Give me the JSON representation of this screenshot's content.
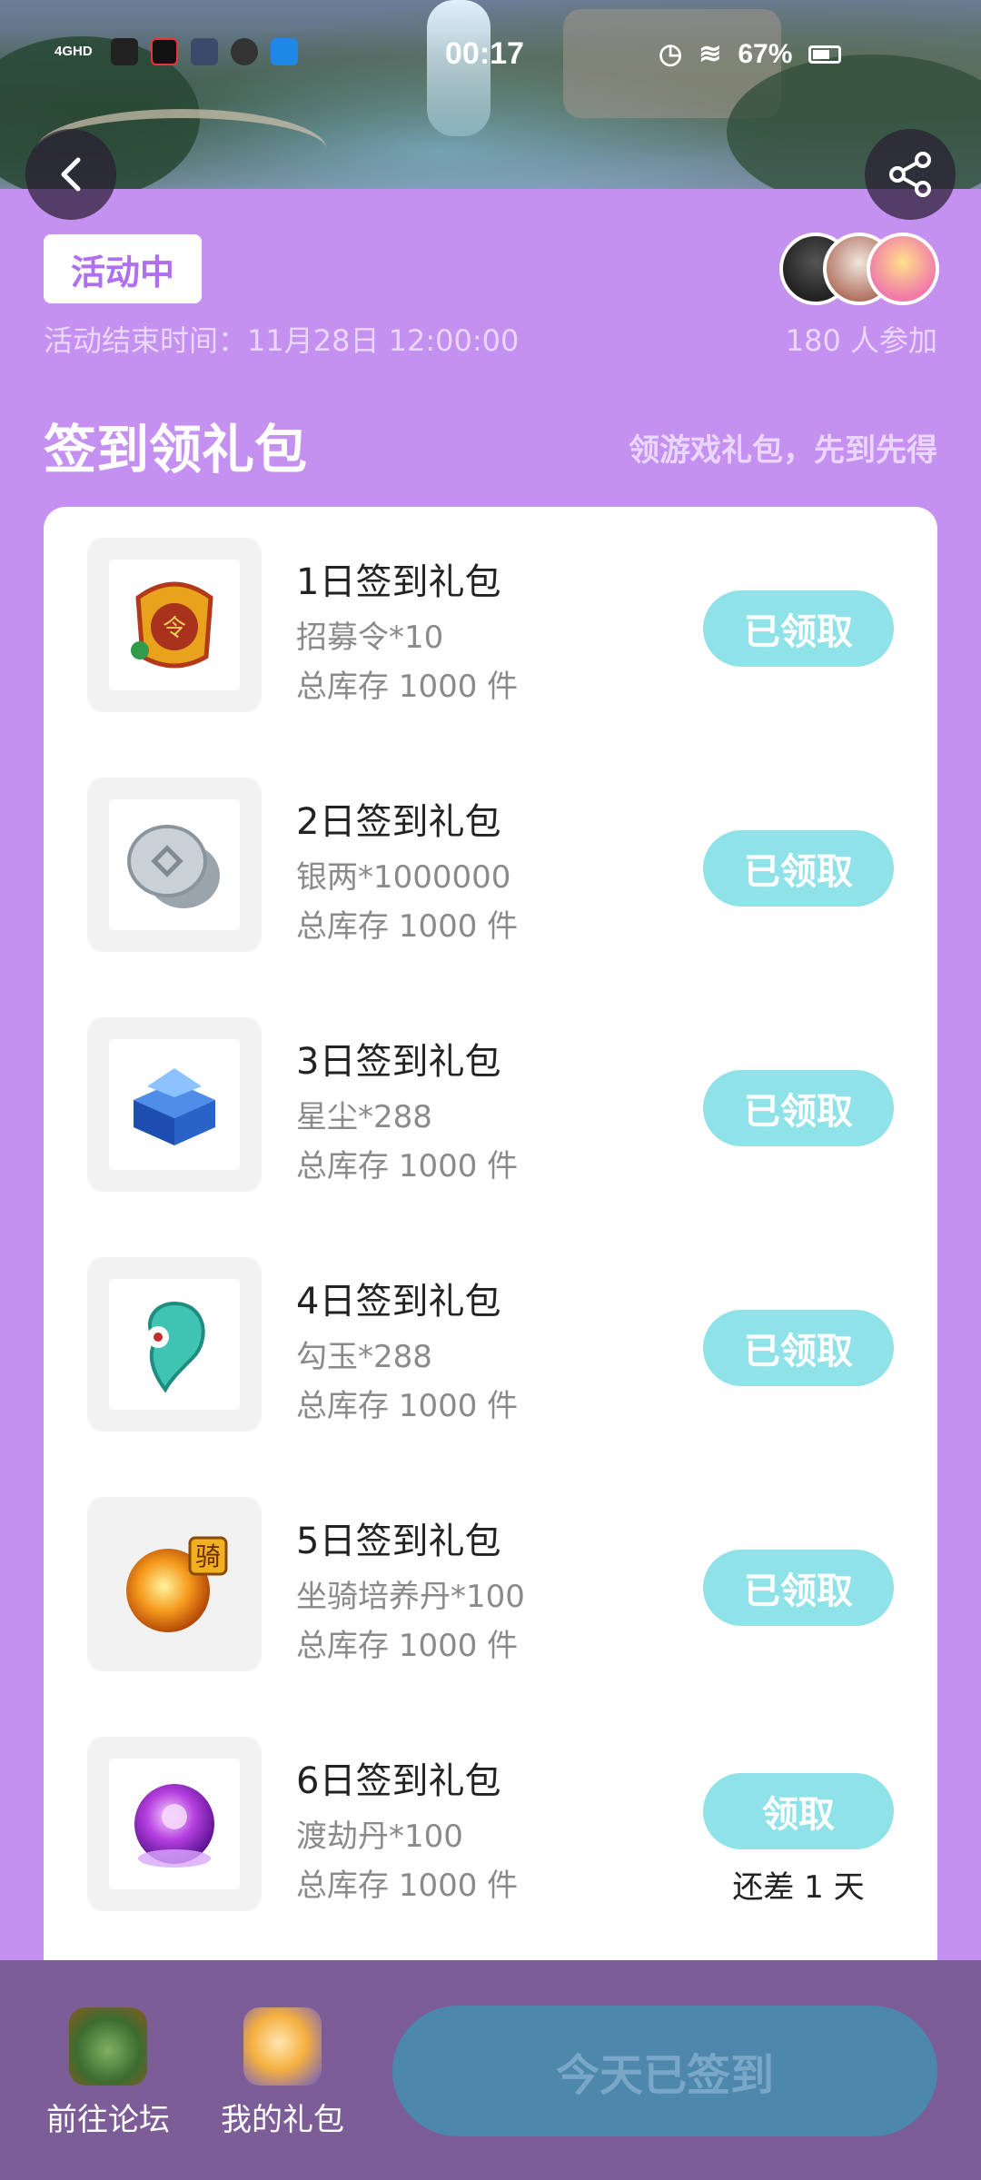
{
  "status_bar": {
    "network": "4GHD",
    "time": "00:17",
    "battery": "67%"
  },
  "activity": {
    "status_badge": "活动中",
    "end_time": "活动结束时间：11月28日 12:00:00",
    "participants": "180 人参加"
  },
  "section": {
    "title": "签到领礼包",
    "subtitle": "领游戏礼包，先到先得"
  },
  "gifts": [
    {
      "name": "1日签到礼包",
      "content": "招募令*10",
      "stock": "总库存 1000 件",
      "button": "已领取",
      "icon": "recruit-token-icon"
    },
    {
      "name": "2日签到礼包",
      "content": "银两*1000000",
      "stock": "总库存 1000 件",
      "button": "已领取",
      "icon": "silver-coins-icon"
    },
    {
      "name": "3日签到礼包",
      "content": "星尘*288",
      "stock": "总库存 1000 件",
      "button": "已领取",
      "icon": "stardust-chest-icon"
    },
    {
      "name": "4日签到礼包",
      "content": "勾玉*288",
      "stock": "总库存 1000 件",
      "button": "已领取",
      "icon": "magatama-icon"
    },
    {
      "name": "5日签到礼包",
      "content": "坐骑培养丹*100",
      "stock": "总库存 1000 件",
      "button": "已领取",
      "icon": "mount-pill-icon"
    },
    {
      "name": "6日签到礼包",
      "content": "渡劫丹*100",
      "stock": "总库存 1000 件",
      "button": "领取",
      "remaining": "还差 1 天",
      "icon": "tribulation-pill-icon"
    }
  ],
  "bottom_bar": {
    "forum_label": "前往论坛",
    "my_gifts_label": "我的礼包",
    "signed_button": "今天已签到"
  },
  "colors": {
    "page_background": "#c491f0",
    "claim_button": "#8ee2e8",
    "bottom_bar": "#7c5d97",
    "signed_button": "#4d87ab"
  }
}
